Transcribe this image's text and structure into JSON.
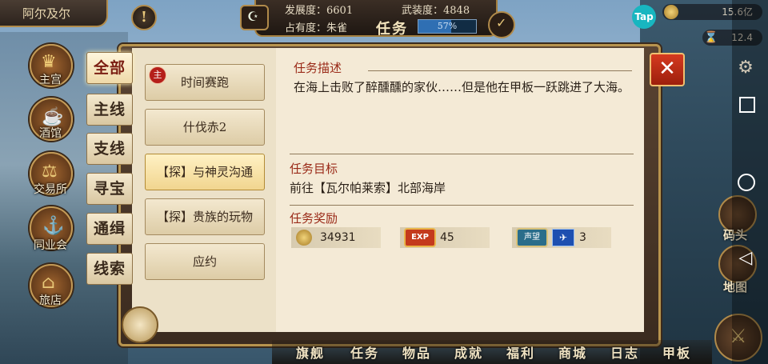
{
  "top": {
    "city": "阿尔及尔",
    "development_label": "发展度：6601",
    "armament_label": "武装度：4848",
    "occupancy_label": "占有度：朱雀",
    "title": "任务",
    "progress_text": "57%",
    "progress_value": 0.57,
    "gold": "15.6亿",
    "time_resource": "12.4",
    "tap_logo": "Tap"
  },
  "left_menu": [
    {
      "label": "主宫",
      "icon": "crown-icon"
    },
    {
      "label": "酒馆",
      "icon": "beer-mug-icon"
    },
    {
      "label": "交易所",
      "icon": "scales-icon"
    },
    {
      "label": "同业会",
      "icon": "anchor-guild-icon"
    },
    {
      "label": "旅店",
      "icon": "inn-icon"
    }
  ],
  "categories": [
    {
      "label": "全部",
      "active": true
    },
    {
      "label": "主线",
      "active": false
    },
    {
      "label": "支线",
      "active": false
    },
    {
      "label": "寻宝",
      "active": false
    },
    {
      "label": "通缉",
      "active": false
    },
    {
      "label": "线索",
      "active": false
    }
  ],
  "tasks": [
    {
      "label": "时间赛跑",
      "badge": "主",
      "active": false
    },
    {
      "label": "什伐赤2",
      "active": false
    },
    {
      "label": "【探】与神灵沟通",
      "active": true
    },
    {
      "label": "【探】贵族的玩物",
      "active": false
    },
    {
      "label": "应约",
      "active": false
    }
  ],
  "detail": {
    "desc_title": "任务描述",
    "desc_text": "在海上击败了醉醺醺的家伙……但是他在甲板一跃跳进了大海。",
    "target_title": "任务目标",
    "target_text": "前往【瓦尔帕莱索】北部海岸",
    "reward_title": "任务奖励",
    "rewards": {
      "gold": "34931",
      "exp_icon": "EXP",
      "exp": "45",
      "reputation_icon": "声望",
      "reputation": "3"
    }
  },
  "bottom_menu": [
    "旗舰",
    "任务",
    "物品",
    "成就",
    "福利",
    "商城",
    "日志",
    "甲板"
  ],
  "right_menu": {
    "dock": "码头",
    "map": "地图"
  },
  "colors": {
    "accent_red": "#9a2a18",
    "frame_gold": "#b8944e",
    "paper": "#f4ead6"
  }
}
